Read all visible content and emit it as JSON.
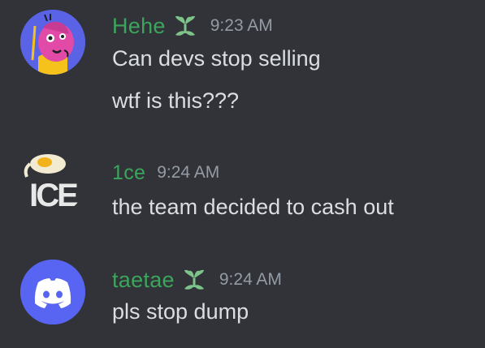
{
  "colors": {
    "background": "#313338",
    "username": "#3ba55c",
    "timestamp": "#949ba4",
    "text": "#dbdee1",
    "discord_blurple": "#5865f2",
    "badge": "#7dc38a"
  },
  "messages": [
    {
      "avatar": "pink-character-avatar",
      "username": "Hehe",
      "badge": "sprout-badge-icon",
      "time": "9:23 AM",
      "lines": [
        "Can devs stop selling",
        "wtf is this???"
      ]
    },
    {
      "avatar": "ice-logo-avatar",
      "username": "1ce",
      "time": "9:24 AM",
      "lines": [
        "the team decided to cash out"
      ]
    },
    {
      "avatar": "discord-logo-avatar",
      "username": "taetae",
      "badge": "sprout-badge-icon",
      "time": "9:24 AM",
      "lines": [
        "pls stop dump"
      ]
    }
  ]
}
